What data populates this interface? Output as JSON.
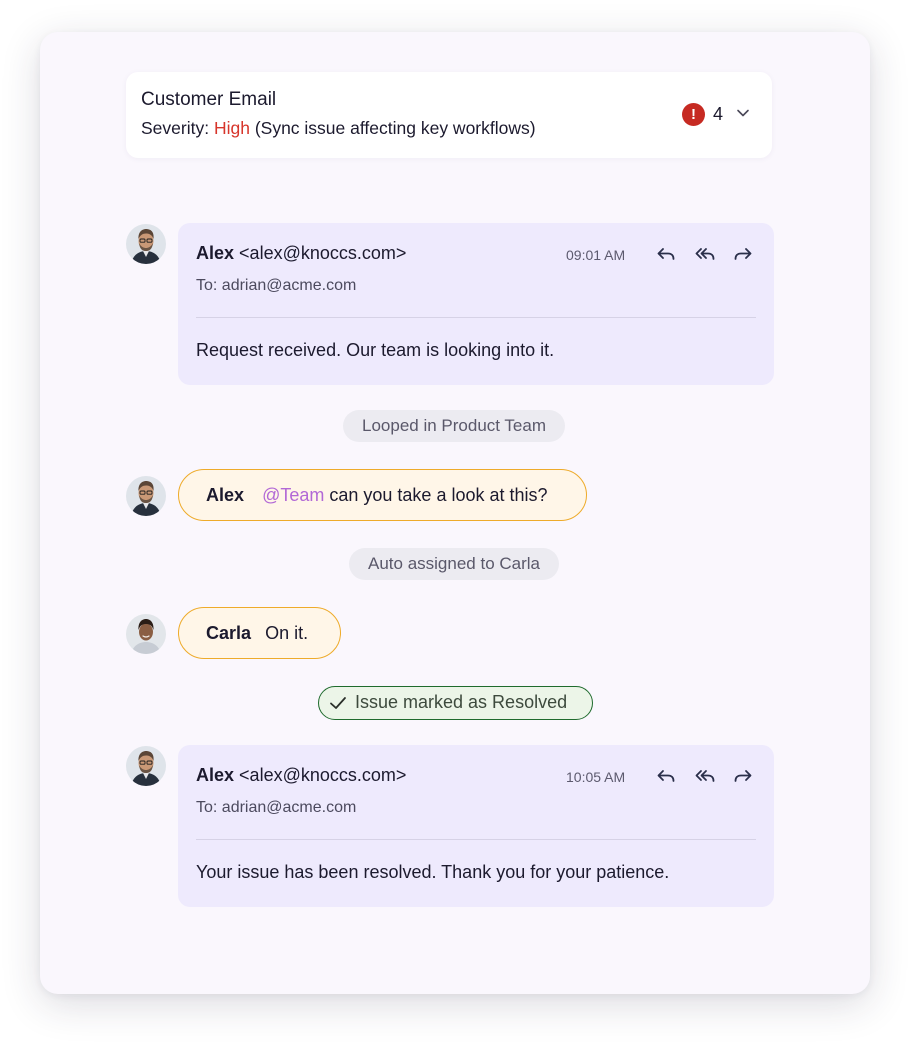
{
  "header": {
    "title": "Customer Email",
    "severity_label": "Severity:",
    "severity_value": "High",
    "severity_note": "(Sync issue affecting key workflows)",
    "alert_badge": "!",
    "alert_count": "4",
    "colors": {
      "high": "#d7352b",
      "badge": "#c62a22"
    }
  },
  "emails": [
    {
      "sender_name": "Alex",
      "sender_email": "<alex@knoccs.com>",
      "time": "09:01 AM",
      "to": "To: adrian@acme.com",
      "body": "Request received. Our team is looking into it."
    },
    {
      "sender_name": "Alex",
      "sender_email": "<alex@knoccs.com>",
      "time": "10:05 AM",
      "to": "To: adrian@acme.com",
      "body": "Your issue has been resolved. Thank you for your patience."
    }
  ],
  "system_events": {
    "looped_in": "Looped in Product Team",
    "auto_assigned": "Auto assigned to Carla",
    "resolved": "Issue marked as Resolved"
  },
  "chats": [
    {
      "sender": "Alex",
      "mention": "@Team",
      "text": "can you take a look at this?"
    },
    {
      "sender": "Carla",
      "text": "On it."
    }
  ],
  "icons": {
    "reply": "reply-icon",
    "reply_all": "reply-all-icon",
    "forward": "forward-icon",
    "expand": "chevron-down-icon",
    "check": "check-icon"
  },
  "colors": {
    "email_bg": "#eeeafd",
    "chat_bg": "#fff6e8",
    "chat_border": "#eeab2a",
    "mention": "#b268d6",
    "resolved_border": "#1f6b2d",
    "resolved_bg": "#ecf5e8"
  }
}
